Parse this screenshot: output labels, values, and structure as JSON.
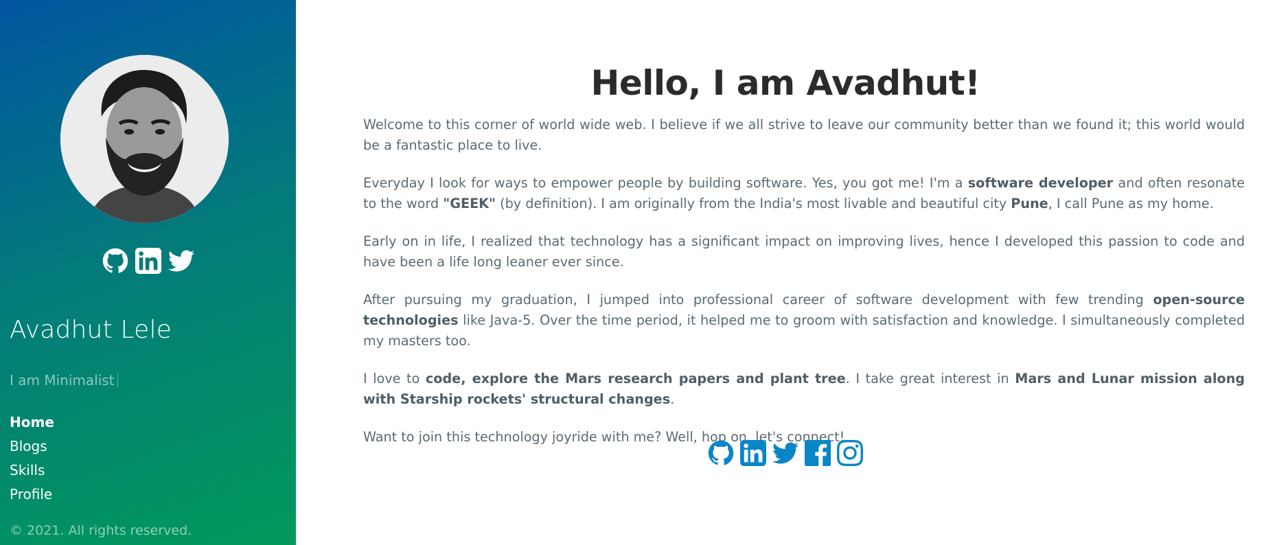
{
  "sidebar": {
    "name": "Avadhut Lele",
    "tagline": "I am Minimalist",
    "social_icons": [
      "github-icon",
      "linkedin-icon",
      "twitter-icon"
    ],
    "nav": [
      {
        "label": "Home",
        "active": true
      },
      {
        "label": "Blogs",
        "active": false
      },
      {
        "label": "Skills",
        "active": false
      },
      {
        "label": "Profile",
        "active": false
      }
    ],
    "copyright": "© 2021. All rights reserved."
  },
  "main": {
    "heading": "Hello, I am Avadhut!",
    "paragraphs": {
      "p1": "Welcome to this corner of world wide web. I believe if we all strive to leave our community better than we found it; this world would be a fantastic place to live.",
      "p2_a": "Everyday I look for ways to empower people by building software. Yes, you got me! I'm a ",
      "p2_b": "software developer",
      "p2_c": " and often resonate to the word ",
      "p2_d": "\"GEEK\"",
      "p2_e": " (by definition). I am originally from the India's most livable and beautiful city ",
      "p2_f": "Pune",
      "p2_g": ", I call Pune as my home.",
      "p3": "Early on in life, I realized that technology has a significant impact on improving lives, hence I developed this passion to code and have been a life long leaner ever since.",
      "p4_a": "After pursuing my graduation, I jumped into professional career of software development with few trending ",
      "p4_b": "open-source technologies",
      "p4_c": " like Java-5. Over the time period, it helped me to groom with satisfaction and knowledge. I simultaneously completed my masters too.",
      "p5_a": "I love to ",
      "p5_b": "code, explore the Mars research papers and plant tree",
      "p5_c": ". I take great interest in ",
      "p5_d": "Mars and Lunar mission along with Starship rockets' structural changes",
      "p5_e": ".",
      "p6": "Want to join this technology joyride with me? Well, hop on, let's connect!"
    },
    "social_icons": [
      "github-icon",
      "linkedin-icon",
      "twitter-icon",
      "facebook-icon",
      "instagram-icon"
    ]
  },
  "colors": {
    "sidebar_gradient_start": "#0155a0",
    "sidebar_gradient_end": "#029a5a",
    "heading": "#2b2b2b",
    "body_text": "#5a6a72",
    "social_accent": "#0a86c7"
  }
}
